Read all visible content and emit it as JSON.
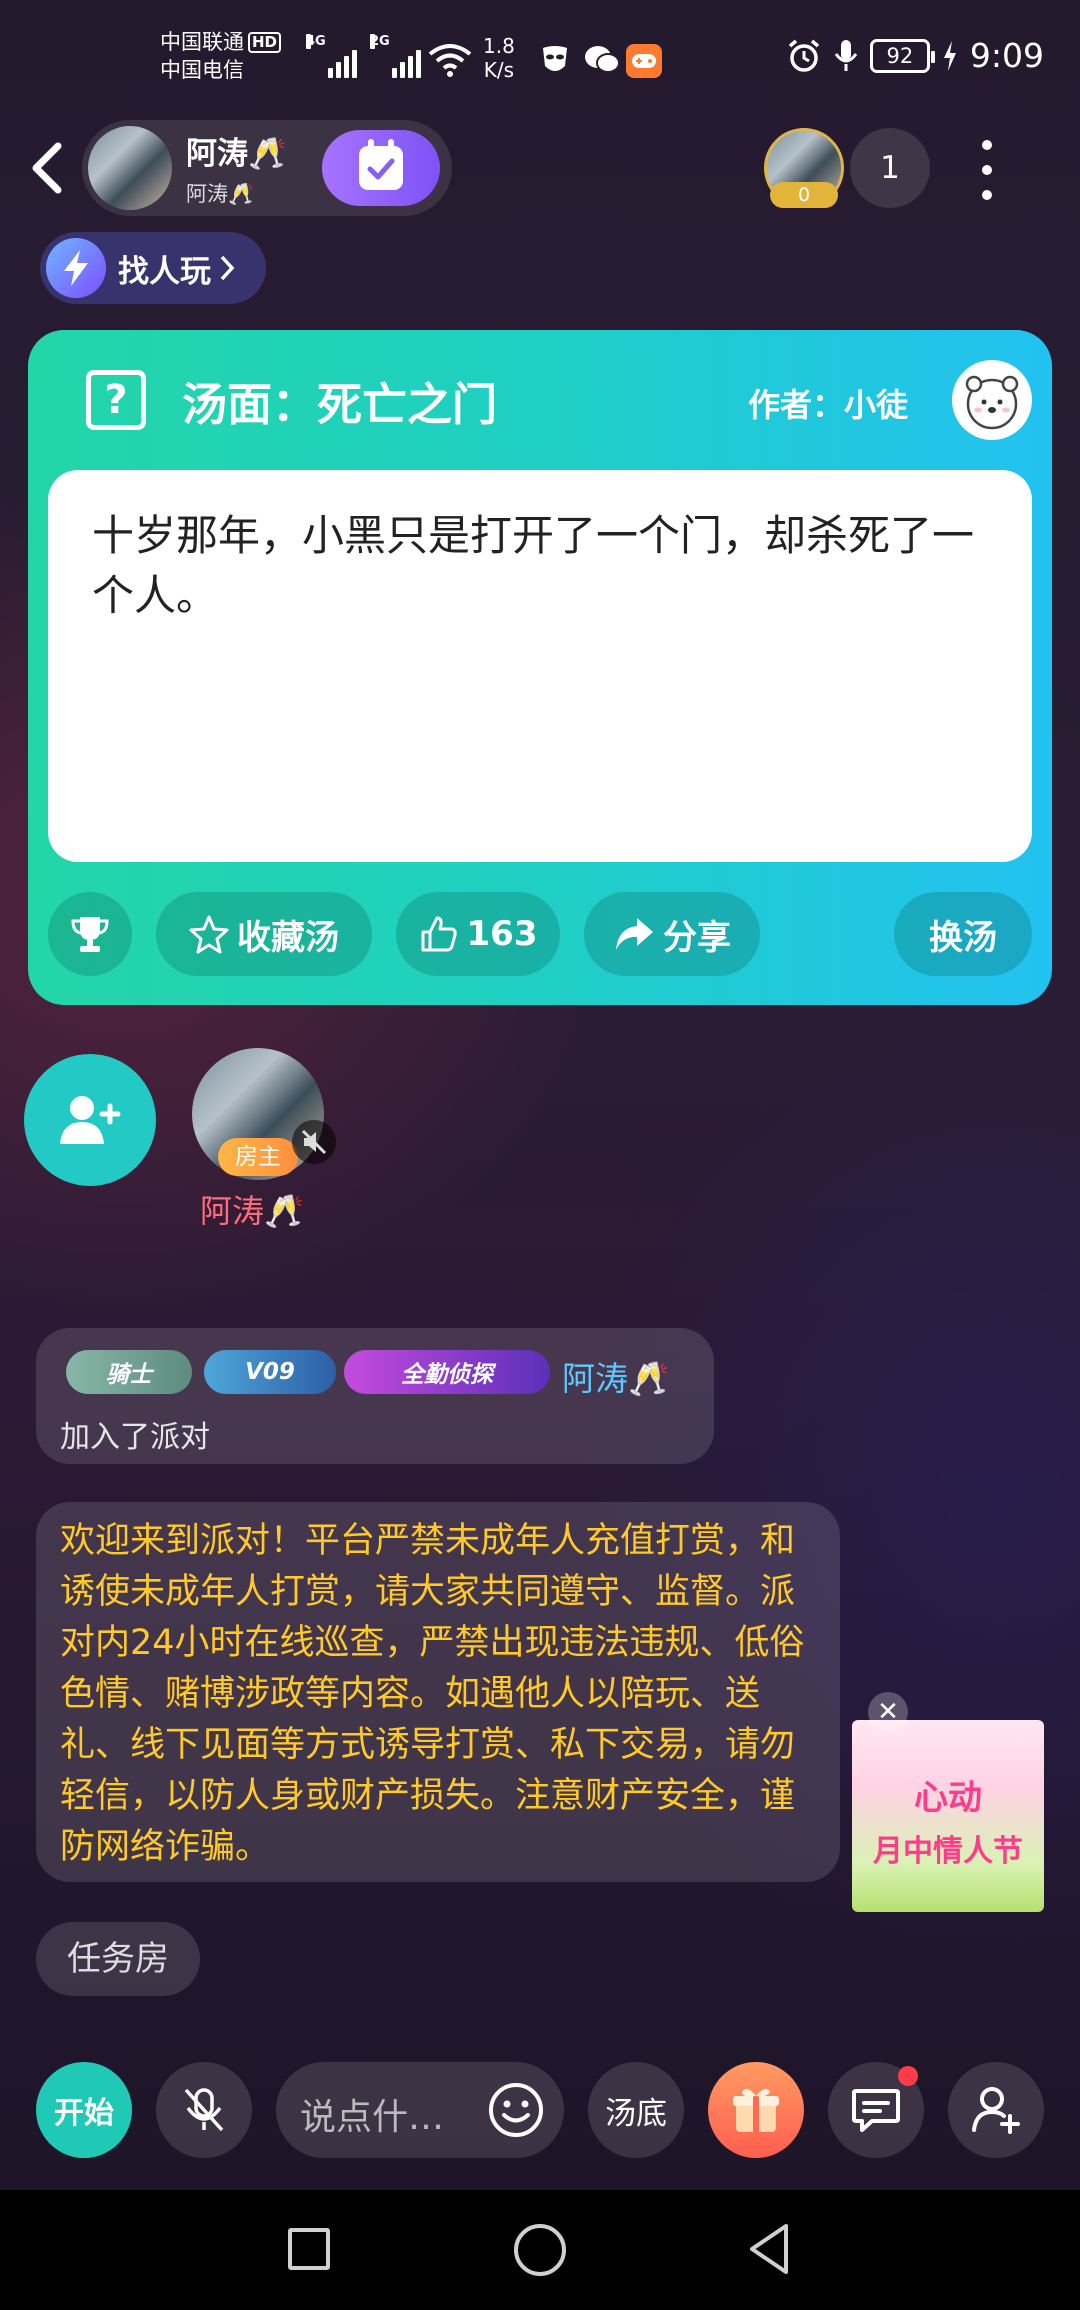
{
  "status_bar": {
    "carrier1": "中国联通",
    "hd": "HD",
    "carrier2": "中国电信",
    "net1": "4G",
    "net2": "2G",
    "speed_value": "1.8",
    "speed_unit": "K/s",
    "battery": "92",
    "time": "9:09"
  },
  "header": {
    "host_name": "阿涛🥂",
    "host_sub": "阿涛🥂",
    "viewer_badge": "0",
    "viewer_count": "1"
  },
  "find_button": {
    "label": "找人玩"
  },
  "soup_card": {
    "title": "汤面：死亡之门",
    "author": "作者：小徒",
    "story": "十岁那年，小黑只是打开了一个门，却杀死了一个人。",
    "actions": {
      "collect": "收藏汤",
      "likes": "163",
      "share": "分享",
      "change": "换汤"
    }
  },
  "seat": {
    "host_tag": "房主",
    "name": "阿涛🥂"
  },
  "chat": {
    "badges": [
      "骑士",
      "V09",
      "全勤侦探"
    ],
    "join_name": "阿涛🥂",
    "join_text": "加入了派对",
    "notice": "欢迎来到派对！平台严禁未成年人充值打赏，和诱使未成年人打赏，请大家共同遵守、监督。派对内24小时在线巡查，严禁出现违法违规、低俗色情、赌博涉政等内容。如遇他人以陪玩、送礼、线下见面等方式诱导打赏、私下交易，请勿轻信，以防人身或财产损失。注意财产安全，谨防网络诈骗。",
    "task_chip": "任务房"
  },
  "promo": {
    "line1": "心动",
    "line2": "月中情人节"
  },
  "toolbar": {
    "start": "开始",
    "input_placeholder": "说点什…",
    "soup_bottom": "汤底"
  },
  "colors": {
    "card_start": "#23d6a8",
    "card_end": "#22c2f1",
    "notice_text": "#ffc928",
    "accent_teal": "#1fc9b6"
  }
}
